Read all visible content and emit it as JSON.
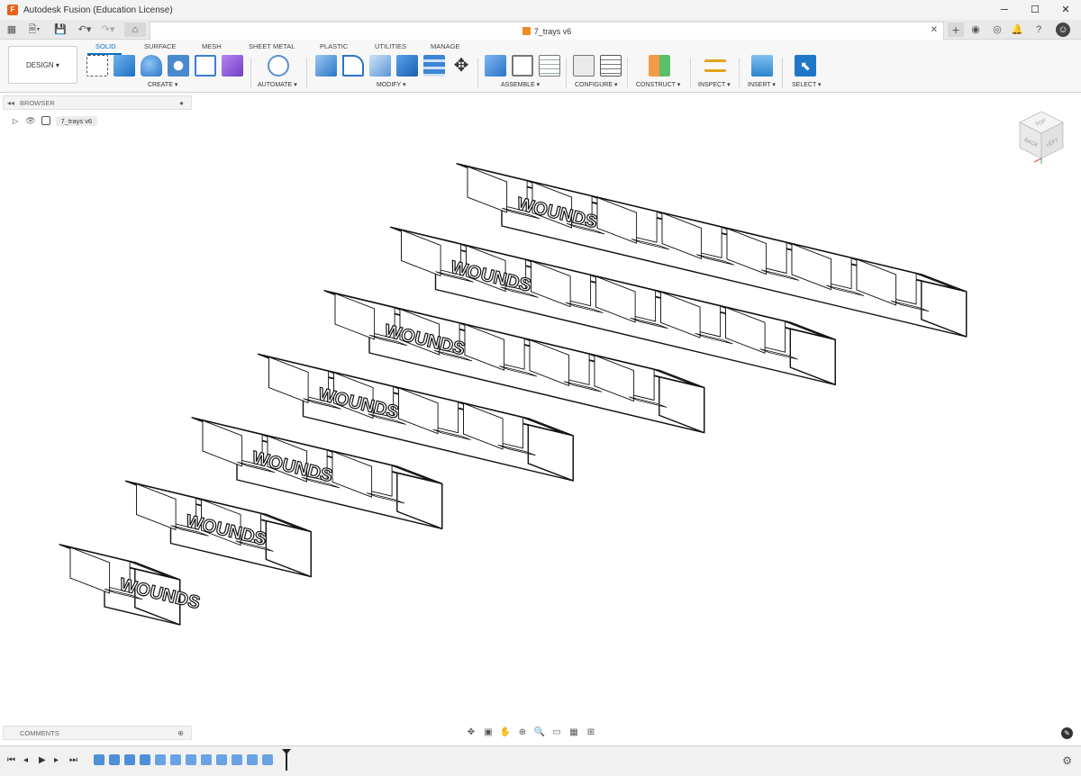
{
  "window": {
    "title": "Autodesk Fusion (Education License)",
    "controls": [
      "─",
      "☐",
      "✕"
    ]
  },
  "document": {
    "tab_title": "7_trays v6"
  },
  "workspace": {
    "mode_label": "DESIGN ▾",
    "tabs": [
      "SOLID",
      "SURFACE",
      "MESH",
      "SHEET METAL",
      "PLASTIC",
      "UTILITIES",
      "MANAGE"
    ],
    "active_tab": "SOLID",
    "groups": [
      "CREATE ▾",
      "AUTOMATE ▾",
      "MODIFY ▾",
      "ASSEMBLE ▾",
      "CONFIGURE ▾",
      "CONSTRUCT ▾",
      "INSPECT ▾",
      "INSERT ▾",
      "SELECT ▾"
    ]
  },
  "browser": {
    "header": "BROWSER",
    "root_item": "7_trays v6"
  },
  "comments": {
    "header": "COMMENTS"
  },
  "model": {
    "tray_text": "WOUNDS",
    "tray_cell_counts": [
      1,
      2,
      3,
      4,
      5,
      6,
      7
    ]
  },
  "viewcube": {
    "faces": [
      "TOP",
      "BACK",
      "LEFT"
    ]
  },
  "colors": {
    "accent": "#0a6ebd",
    "brand": "#e8611a"
  }
}
